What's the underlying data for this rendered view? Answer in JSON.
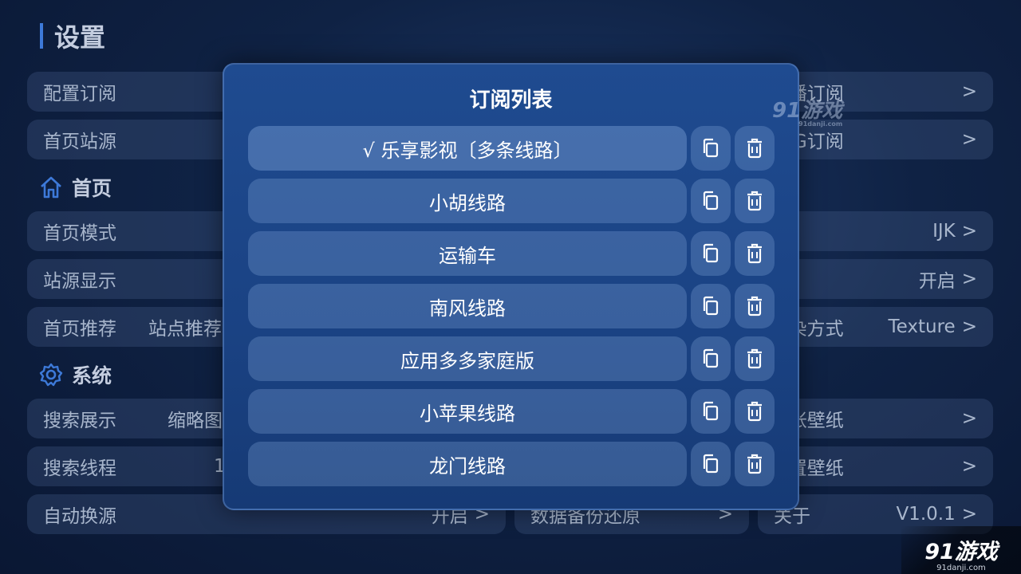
{
  "page": {
    "title": "设置"
  },
  "config_rows": {
    "subscription": {
      "label": "配置订阅",
      "right_label": "播订阅",
      "chevron": ">"
    },
    "home_source": {
      "label": "首页站源",
      "right_label": "G订阅",
      "chevron": ">"
    }
  },
  "section_home": {
    "title": "首页",
    "icon": "home-icon"
  },
  "home_rows": {
    "mode": {
      "label": "首页模式",
      "value": "IJK",
      "chevron": ">"
    },
    "source_display": {
      "label": "站源显示",
      "value": "开启",
      "chevron": ">"
    },
    "recommend": {
      "label": "首页推荐",
      "value_left": "站点推荐",
      "right_label": "染方式",
      "value": "Texture",
      "chevron": ">"
    }
  },
  "section_system": {
    "title": "系统",
    "icon": "gear-icon"
  },
  "system_rows": {
    "search_display": {
      "label": "搜索展示",
      "value_left": "缩略图",
      "right_label": "张壁纸",
      "chevron": ">"
    },
    "search_threads": {
      "label": "搜索线程",
      "value_left": "1",
      "right_label": "置壁纸",
      "chevron": ">"
    },
    "auto_switch": {
      "label": "自动换源",
      "value": "开启",
      "chevron": ">"
    },
    "backup": {
      "label": "数据备份还原",
      "chevron": ">"
    },
    "about": {
      "label": "关于",
      "value": "V1.0.1",
      "chevron": ">"
    }
  },
  "dialog": {
    "title": "订阅列表",
    "items": [
      {
        "label": "√ 乐享影视〔多条线路〕",
        "selected": true
      },
      {
        "label": "小胡线路",
        "selected": false
      },
      {
        "label": "运输车",
        "selected": false
      },
      {
        "label": "南风线路",
        "selected": false
      },
      {
        "label": "应用多多家庭版",
        "selected": false
      },
      {
        "label": "小苹果线路",
        "selected": false
      },
      {
        "label": "龙门线路",
        "selected": false
      }
    ]
  },
  "watermark": {
    "text": "91游戏",
    "domain": "91danji.com"
  },
  "corner_logo": {
    "text": "91游戏",
    "domain": "91danji.com"
  },
  "colors": {
    "accent": "#3d79d8",
    "dialog_bg": "#1d468a",
    "background": "#0f2244"
  }
}
